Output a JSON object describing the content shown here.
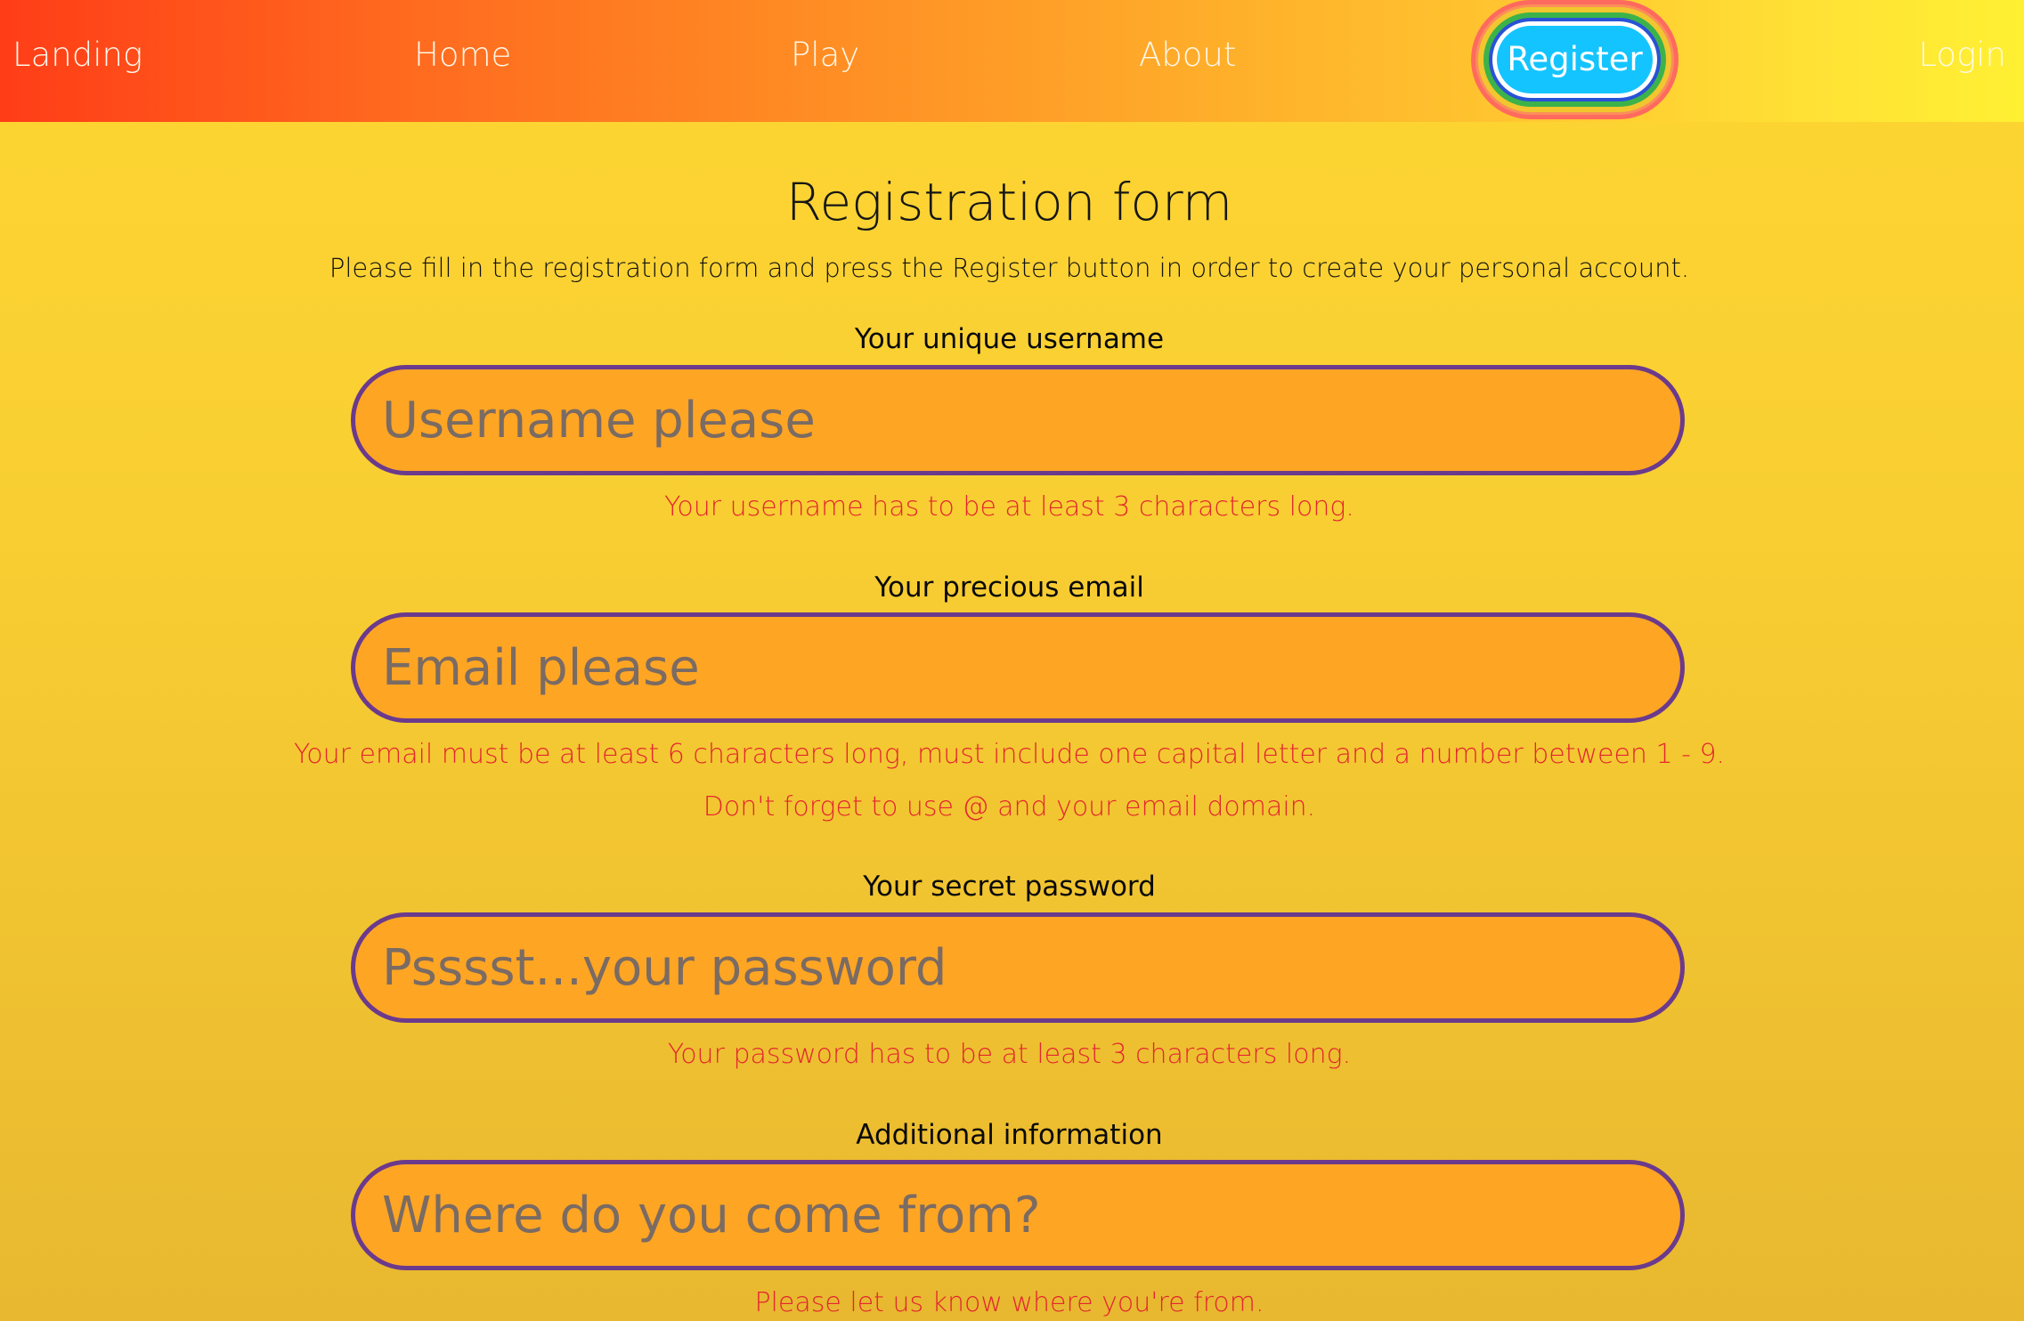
{
  "nav": {
    "landing": "Landing",
    "home": "Home",
    "play": "Play",
    "about": "About",
    "register": "Register",
    "login": "Login"
  },
  "form": {
    "title": "Registration form",
    "intro": "Please fill in the registration form and press the Register button in order to create your personal account.",
    "username": {
      "label": "Your unique username",
      "placeholder": "Username please",
      "hint": "Your username has to be at least 3 characters long."
    },
    "email": {
      "label": "Your precious email",
      "placeholder": "Email please",
      "hint_line1": "Your email must be at least 6 characters long, must include one capital letter and a number between 1 - 9.",
      "hint_line2": "Don't forget to use @ and your email domain."
    },
    "password": {
      "label": "Your secret password",
      "placeholder": "Psssst...your password",
      "hint": "Your password has to be at least 3 characters long."
    },
    "additional": {
      "label": "Additional information",
      "placeholder": "Where do you come from?",
      "hint": "Please let us know where you're from."
    }
  },
  "colors": {
    "nav_gradient_start": "#ff3d17",
    "nav_gradient_end": "#fff033",
    "page_background": "#fed632",
    "input_fill": "#ffa524",
    "input_border": "#6b3a8c",
    "hint_text": "#e3262e",
    "register_button": "#14c4ff"
  }
}
